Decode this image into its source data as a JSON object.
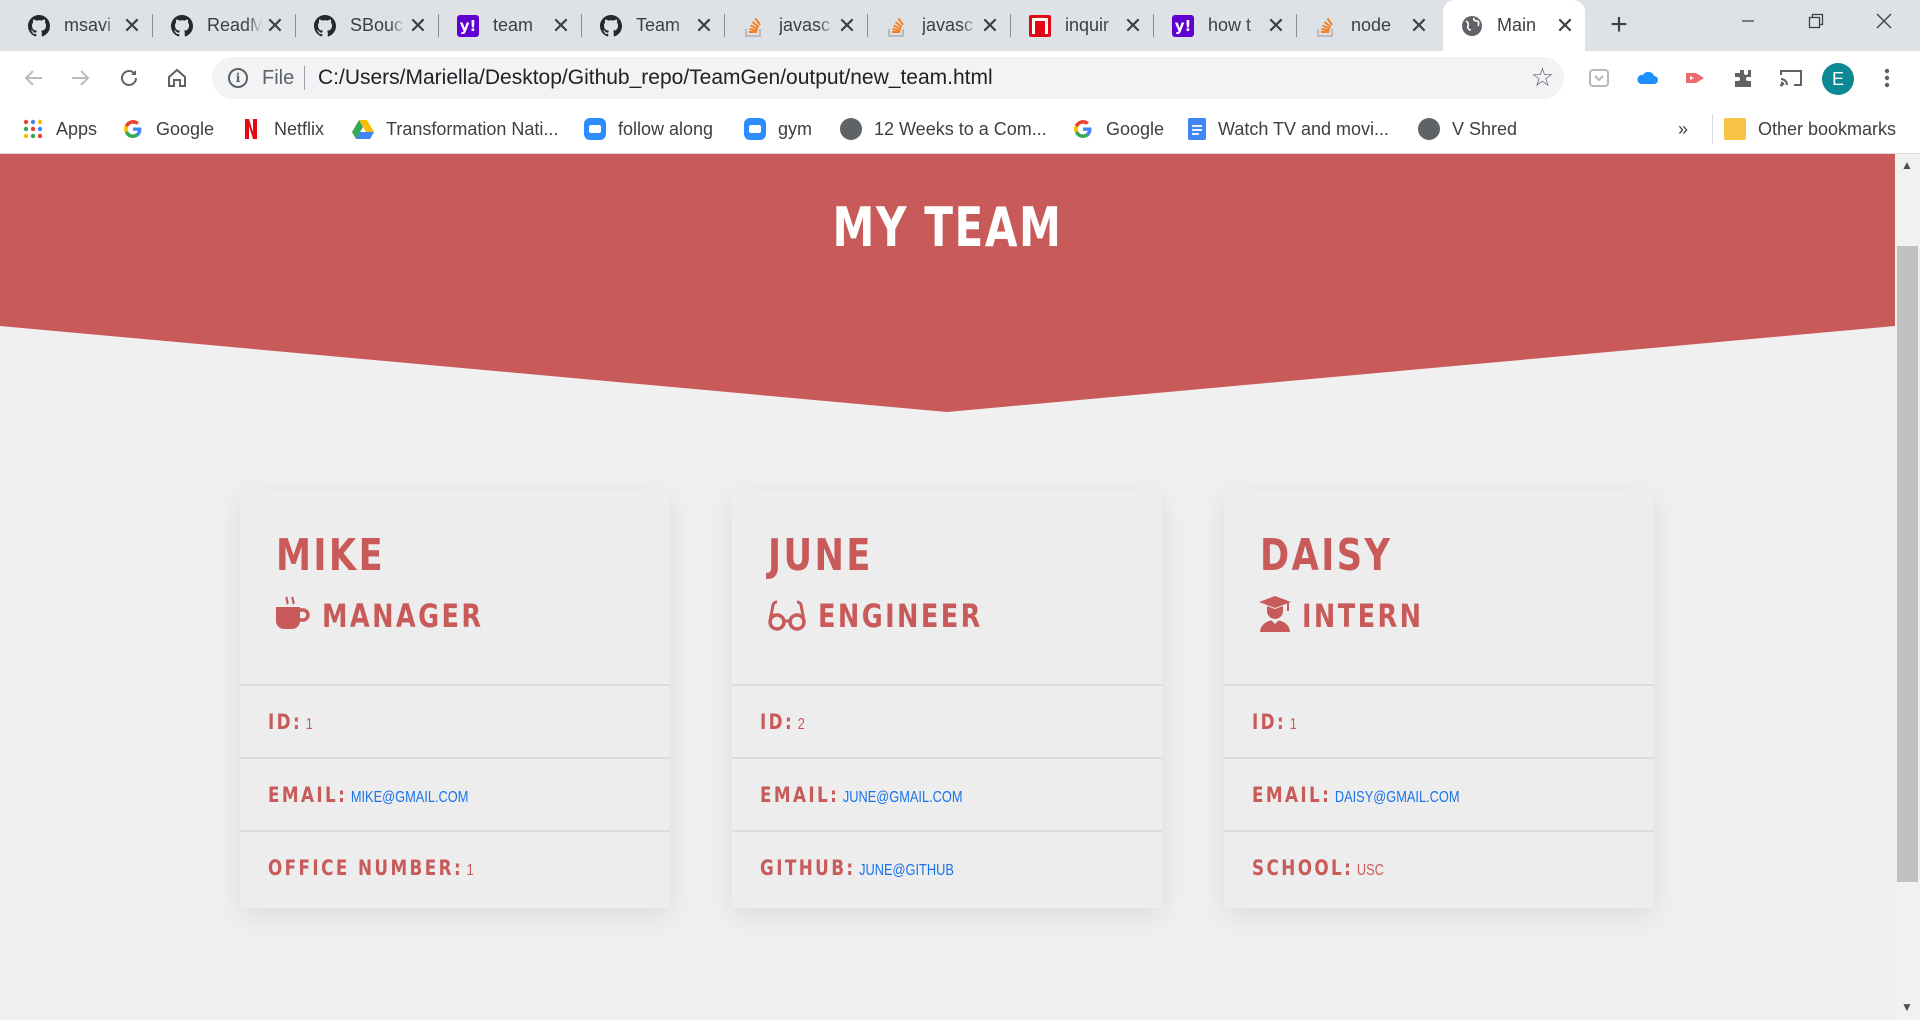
{
  "browser": {
    "tabs": [
      {
        "title": "msavi",
        "icon": "github-icon",
        "active": false
      },
      {
        "title": "ReadM",
        "icon": "github-icon",
        "active": false
      },
      {
        "title": "SBouc",
        "icon": "github-icon",
        "active": false
      },
      {
        "title": "team",
        "icon": "yahoo-icon",
        "active": false
      },
      {
        "title": "Team",
        "icon": "github-icon",
        "active": false
      },
      {
        "title": "javasc",
        "icon": "stackoverflow-icon",
        "active": false
      },
      {
        "title": "javasc",
        "icon": "stackoverflow-icon",
        "active": false
      },
      {
        "title": "inquir",
        "icon": "npm-icon",
        "active": false
      },
      {
        "title": "how t",
        "icon": "yahoo-icon",
        "active": false
      },
      {
        "title": "node",
        "icon": "stackoverflow-icon",
        "active": false
      },
      {
        "title": "Main",
        "icon": "globe-icon",
        "active": true
      }
    ],
    "yahoo_glyph": "y!",
    "address": {
      "scheme_label": "File",
      "url": "C:/Users/Mariella/Desktop/Github_repo/TeamGen/output/new_team.html"
    },
    "profile_initial": "E",
    "bookmarks": [
      {
        "label": "Apps",
        "icon": "apps-grid-icon"
      },
      {
        "label": "Google",
        "icon": "google-icon"
      },
      {
        "label": "Netflix",
        "icon": "netflix-icon"
      },
      {
        "label": "Transformation Nati...",
        "icon": "google-drive-icon"
      },
      {
        "label": "follow along",
        "icon": "zoom-icon"
      },
      {
        "label": "gym",
        "icon": "zoom-icon"
      },
      {
        "label": "12 Weeks to a Com...",
        "icon": "globe-icon"
      },
      {
        "label": "Google",
        "icon": "google-icon"
      },
      {
        "label": "Watch TV and movi...",
        "icon": "docs-icon"
      },
      {
        "label": "V Shred",
        "icon": "globe-icon"
      }
    ],
    "bookmarks_overflow": "»",
    "other_bookmarks": "Other bookmarks"
  },
  "page": {
    "title": "MY TEAM",
    "colors": {
      "accent": "#c85a5a",
      "link": "#1a73e8",
      "background": "#f0f0f0",
      "card": "#ededed"
    },
    "cards": [
      {
        "name": "MIKE",
        "role": "MANAGER",
        "role_icon": "coffee-mug-icon",
        "id_label": "ID:",
        "id_value": "1",
        "email_label": "EMAIL:",
        "email_value": "MIKE@GMAIL.COM",
        "extra_label": "OFFICE NUMBER:",
        "extra_value": "1"
      },
      {
        "name": "JUNE",
        "role": "ENGINEER",
        "role_icon": "glasses-icon",
        "id_label": "ID:",
        "id_value": "2",
        "email_label": "EMAIL:",
        "email_value": "JUNE@GMAIL.COM",
        "extra_label": "GITHUB:",
        "extra_value": "JUNE@GITHUB"
      },
      {
        "name": "DAISY",
        "role": "INTERN",
        "role_icon": "graduate-icon",
        "id_label": "ID:",
        "id_value": "1",
        "email_label": "EMAIL:",
        "email_value": "DAISY@GMAIL.COM",
        "extra_label": "SCHOOL:",
        "extra_value": "USC"
      }
    ]
  }
}
